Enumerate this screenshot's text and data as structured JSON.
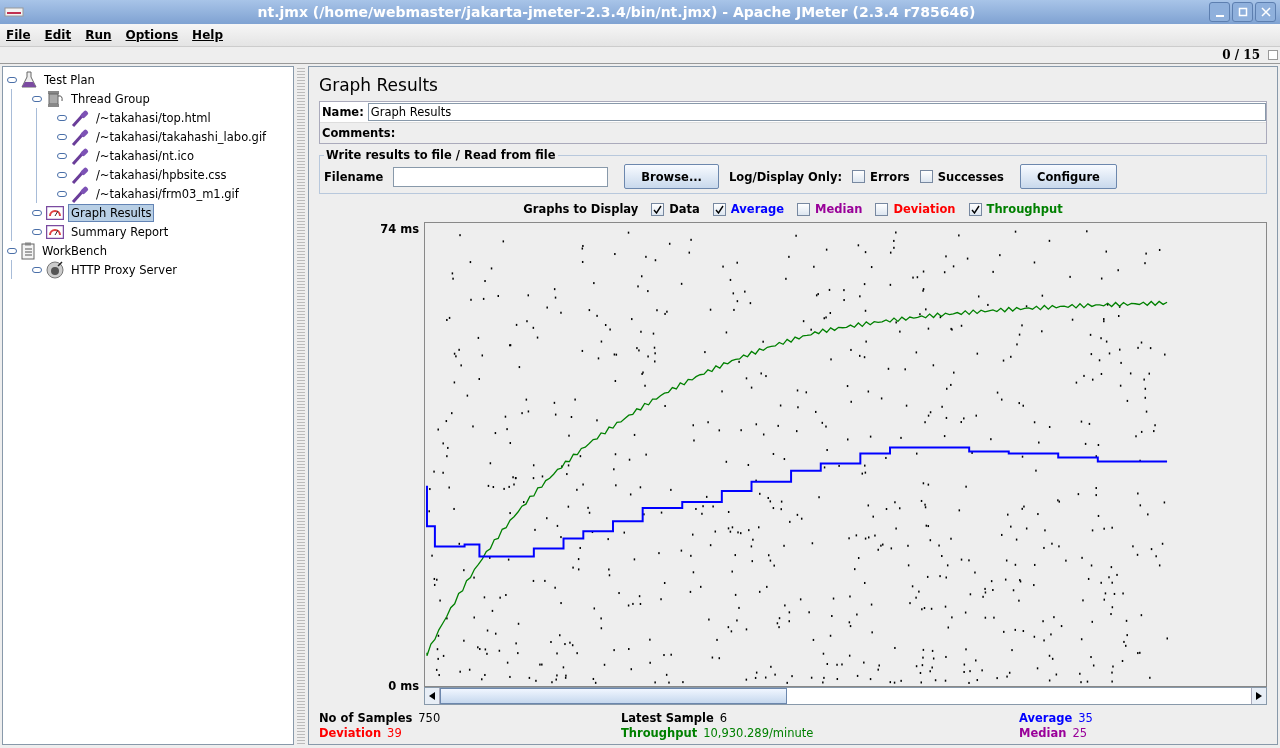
{
  "window": {
    "title": "nt.jmx (/home/webmaster/jakarta-jmeter-2.3.4/bin/nt.jmx) - Apache JMeter (2.3.4 r785646)"
  },
  "menu": [
    "File",
    "Edit",
    "Run",
    "Options",
    "Help"
  ],
  "thread_counter": "0 / 15",
  "tree": [
    {
      "label": "Test Plan",
      "kind": "plan",
      "selected": false,
      "children": [
        {
          "label": "Thread Group",
          "kind": "thread",
          "selected": false,
          "children": [
            {
              "label": "/~takahasi/top.html",
              "kind": "sampler",
              "selected": false
            },
            {
              "label": "/~takahasi/takahashi_labo.gif",
              "kind": "sampler",
              "selected": false
            },
            {
              "label": "/~takahasi/nt.ico",
              "kind": "sampler",
              "selected": false
            },
            {
              "label": "/~takahasi/hpbsite.css",
              "kind": "sampler",
              "selected": false
            },
            {
              "label": "/~takahasi/frm03_m1.gif",
              "kind": "sampler",
              "selected": false
            }
          ]
        },
        {
          "label": "Graph Results",
          "kind": "listener",
          "selected": true
        },
        {
          "label": "Summary Report",
          "kind": "listener",
          "selected": false
        }
      ]
    },
    {
      "label": "WorkBench",
      "kind": "workbench",
      "selected": false,
      "children": [
        {
          "label": "HTTP Proxy Server",
          "kind": "proxy",
          "selected": false
        }
      ]
    }
  ],
  "panel": {
    "title": "Graph Results",
    "name_label": "Name:",
    "name_value": "Graph Results",
    "comments_label": "Comments:"
  },
  "file_group": {
    "legend": "Write results to file / Read from file",
    "filename_label": "Filename",
    "browse": "Browse...",
    "log_label": "Log/Display Only:",
    "options": [
      {
        "label": "Errors",
        "checked": false
      },
      {
        "label": "Successes",
        "checked": false
      }
    ],
    "configure": "Configure"
  },
  "graphs_label": "Graphs to Display",
  "graphs": [
    {
      "label": "Data",
      "checked": true,
      "color": "#000000"
    },
    {
      "label": "Average",
      "checked": true,
      "color": "#0000ff"
    },
    {
      "label": "Median",
      "checked": false,
      "color": "#990099"
    },
    {
      "label": "Deviation",
      "checked": false,
      "color": "#ff0000"
    },
    {
      "label": "Throughput",
      "checked": true,
      "color": "#008000"
    }
  ],
  "y_max": "74 ms",
  "y_min": "0 ms",
  "stats": [
    {
      "label": "No of Samples",
      "value": "750",
      "color": "#000000"
    },
    {
      "label": "Latest Sample",
      "value": "6",
      "color": "#000000"
    },
    {
      "label": "Average",
      "value": "35",
      "color": "#0000ff"
    },
    {
      "label": "Deviation",
      "value": "39",
      "color": "#ff0000"
    },
    {
      "label": "Throughput",
      "value": "10,930.289/minute",
      "color": "#008000"
    },
    {
      "label": "Median",
      "value": "25",
      "color": "#990099"
    }
  ]
}
